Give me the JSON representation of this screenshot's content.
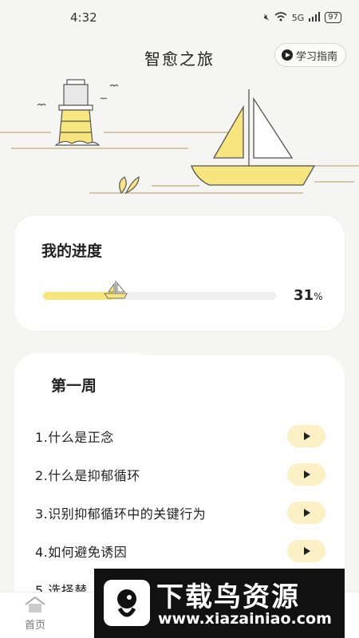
{
  "status_bar": {
    "time": "4:32",
    "signal_text": "5G",
    "battery": "97"
  },
  "header": {
    "title": "智愈之旅",
    "guide_label": "学习指南"
  },
  "progress": {
    "title": "我的进度",
    "value": "31",
    "unit": "%",
    "fraction": 0.31
  },
  "week": {
    "title": "第一周",
    "lessons": [
      {
        "label": "1.什么是正念"
      },
      {
        "label": "2.什么是抑郁循环"
      },
      {
        "label": "3.识别抑郁循环中的关键行为"
      },
      {
        "label": "4.如何避免诱因"
      },
      {
        "label": "5.选择替"
      }
    ]
  },
  "tabbar": {
    "home_label": "首页"
  },
  "watermark": {
    "title": "下载鸟资源",
    "url": "www.xiazainiao.com"
  },
  "colors": {
    "accent_yellow": "#f7e57e",
    "play_bg": "#fbf1c4",
    "line": "#c9b98c"
  }
}
